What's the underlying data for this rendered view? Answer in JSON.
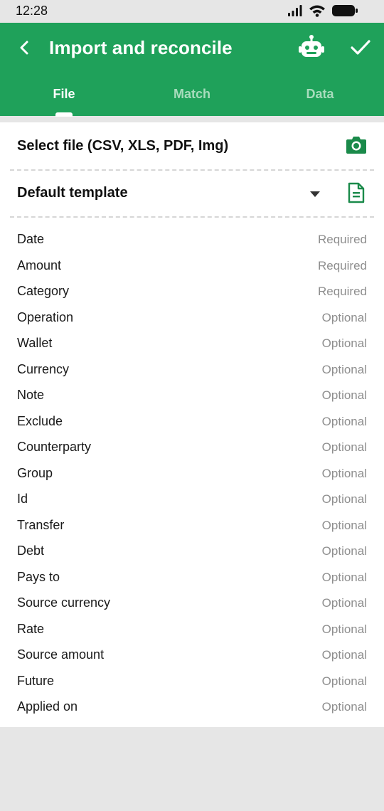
{
  "status": {
    "time": "12:28"
  },
  "appbar": {
    "title": "Import and reconcile",
    "tabs": [
      "File",
      "Match",
      "Data"
    ],
    "active_tab": "File"
  },
  "colors": {
    "primary": "#1fa15a",
    "icon_green": "#1a8a4a"
  },
  "file": {
    "select_label": "Select file (CSV, XLS, PDF, Img)",
    "template_label": "Default template"
  },
  "fields": [
    {
      "name": "Date",
      "status": "Required"
    },
    {
      "name": "Amount",
      "status": "Required"
    },
    {
      "name": "Category",
      "status": "Required"
    },
    {
      "name": "Operation",
      "status": "Optional"
    },
    {
      "name": "Wallet",
      "status": "Optional"
    },
    {
      "name": "Currency",
      "status": "Optional"
    },
    {
      "name": "Note",
      "status": "Optional"
    },
    {
      "name": "Exclude",
      "status": "Optional"
    },
    {
      "name": "Counterparty",
      "status": "Optional"
    },
    {
      "name": "Group",
      "status": "Optional"
    },
    {
      "name": "Id",
      "status": "Optional"
    },
    {
      "name": "Transfer",
      "status": "Optional"
    },
    {
      "name": "Debt",
      "status": "Optional"
    },
    {
      "name": "Pays to",
      "status": "Optional"
    },
    {
      "name": "Source currency",
      "status": "Optional"
    },
    {
      "name": "Rate",
      "status": "Optional"
    },
    {
      "name": "Source amount",
      "status": "Optional"
    },
    {
      "name": "Future",
      "status": "Optional"
    },
    {
      "name": "Applied on",
      "status": "Optional"
    }
  ]
}
